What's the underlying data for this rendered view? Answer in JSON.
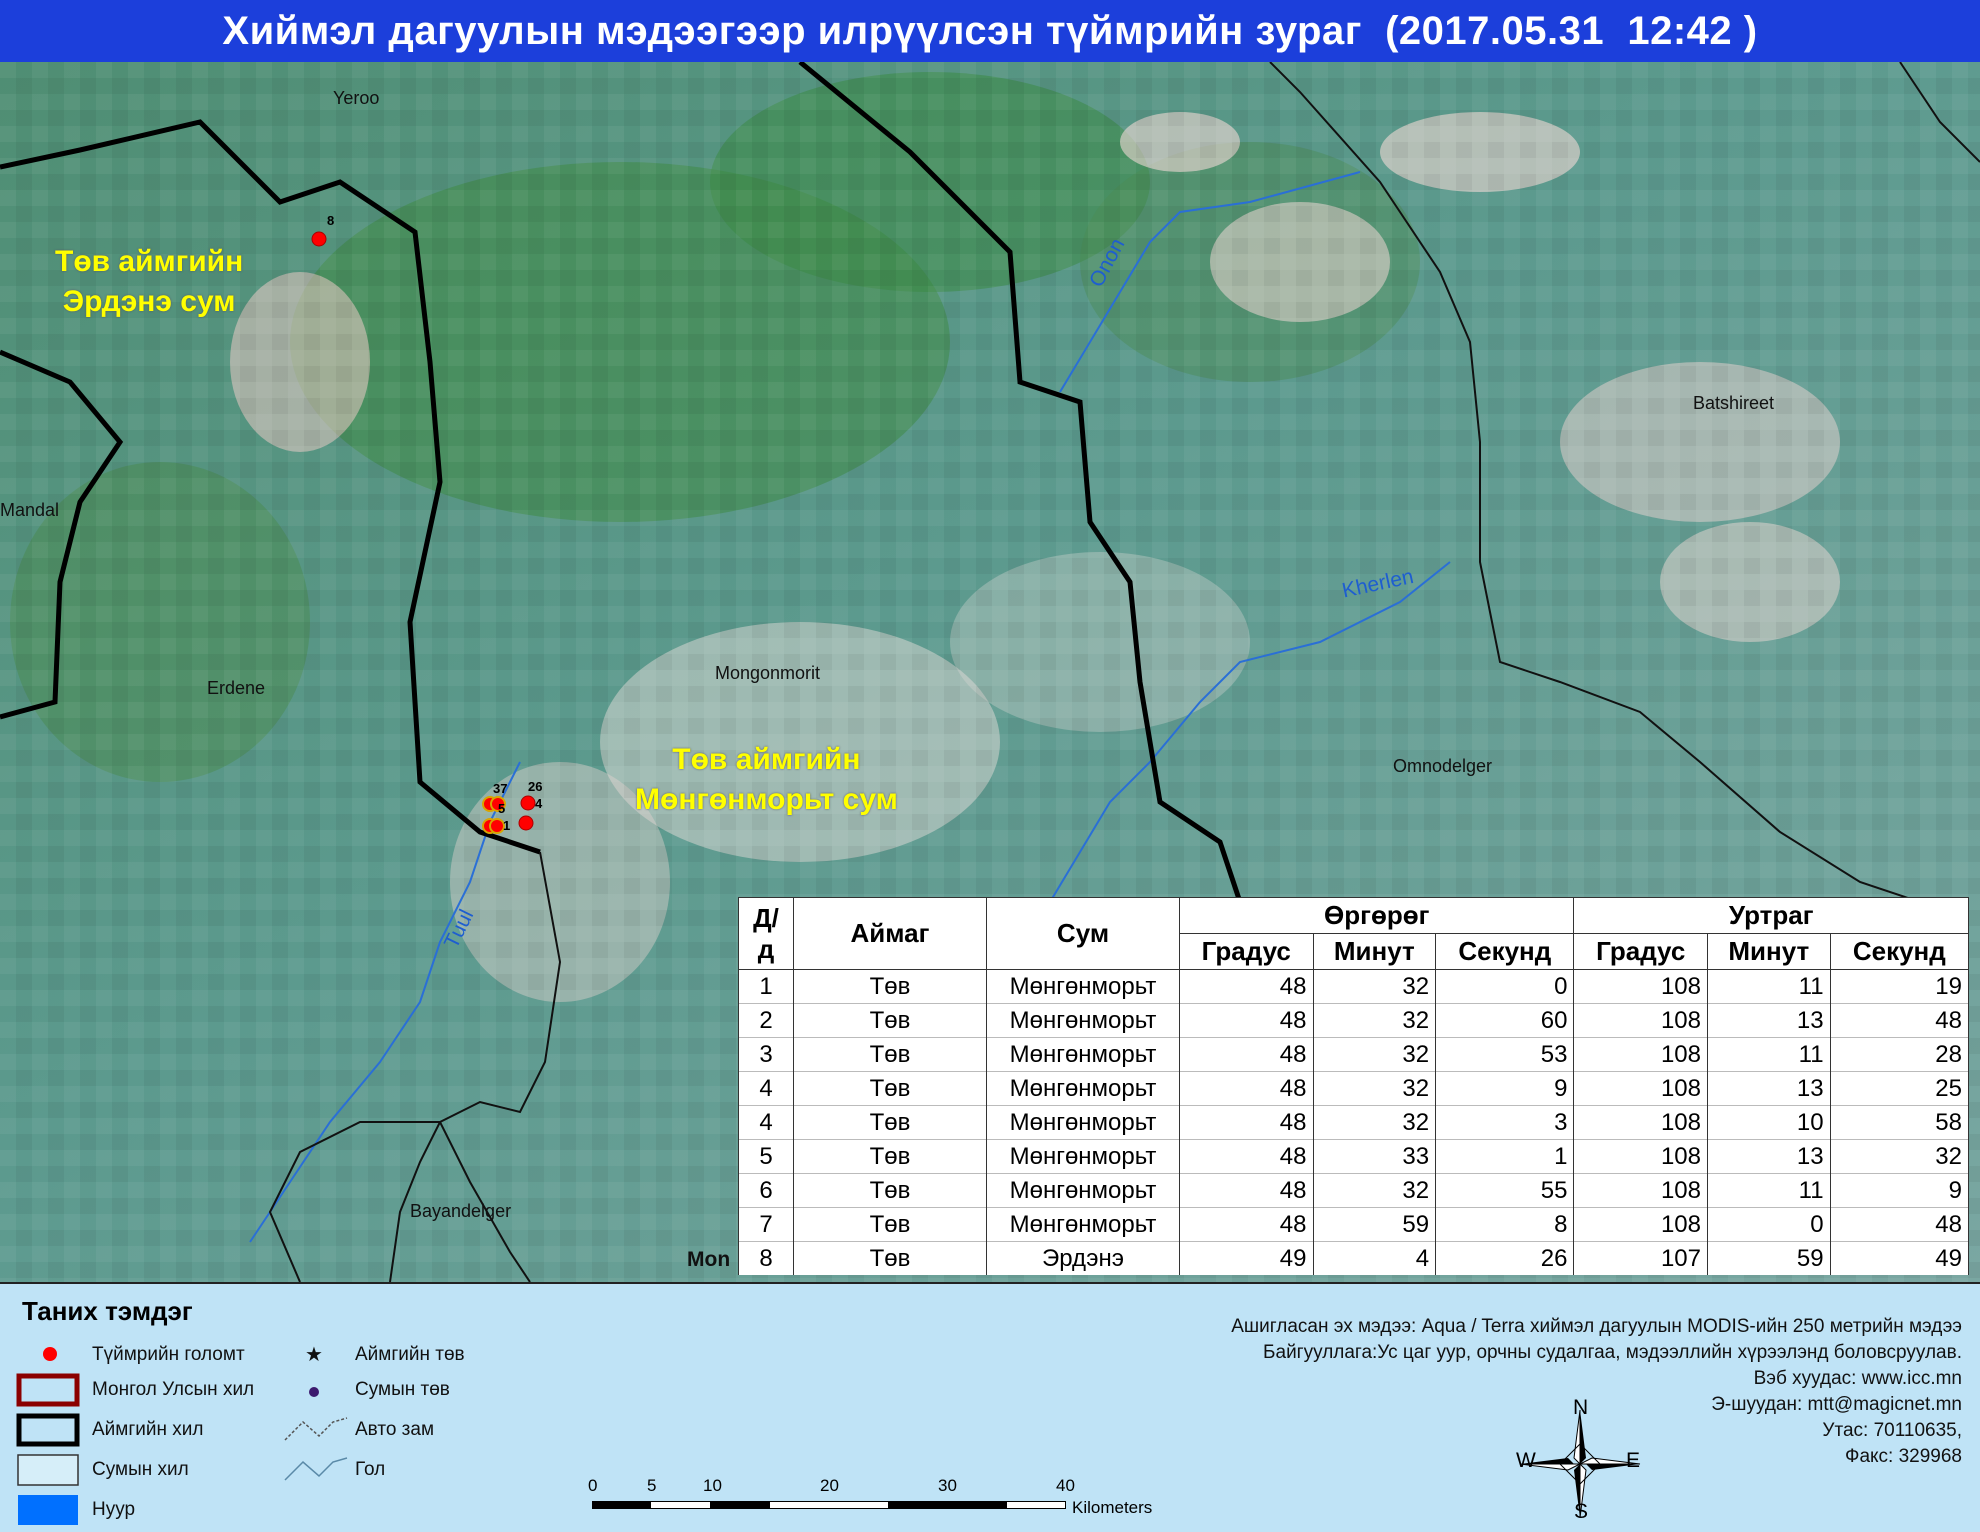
{
  "title": "Хиймэл дагуулын мэдээгээр илрүүлсэн түймрийн зураг  (2017.05.31  12:42 )",
  "map": {
    "places": [
      "Yeroo",
      "Mandal",
      "Erdene",
      "Mongonmorit",
      "Batshireet",
      "Omnodelger",
      "Bayandelger",
      "Mon"
    ],
    "rivers": [
      "Onon",
      "Kherlen",
      "Tuul"
    ],
    "regions": [
      {
        "line1": "Төв аймгийн",
        "line2": "Эрдэнэ сум"
      },
      {
        "line1": "Төв аймгийн",
        "line2": "Мөнгөнморьт сум"
      }
    ],
    "fire_labels": [
      "8",
      "37",
      "26",
      "5",
      "4",
      "1"
    ]
  },
  "table": {
    "headers": {
      "no": "Д/д",
      "aimag": "Аймаг",
      "sum": "Сум",
      "latitude": "Өргөрөг",
      "longitude": "Уртраг",
      "deg": "Градус",
      "min": "Минут",
      "sec": "Секунд"
    },
    "rows": [
      {
        "no": "1",
        "aimag": "Төв",
        "sum": "Мөнгөнморьт",
        "lat_d": "48",
        "lat_m": "32",
        "lat_s": "0",
        "lon_d": "108",
        "lon_m": "11",
        "lon_s": "19"
      },
      {
        "no": "2",
        "aimag": "Төв",
        "sum": "Мөнгөнморьт",
        "lat_d": "48",
        "lat_m": "32",
        "lat_s": "60",
        "lon_d": "108",
        "lon_m": "13",
        "lon_s": "48"
      },
      {
        "no": "3",
        "aimag": "Төв",
        "sum": "Мөнгөнморьт",
        "lat_d": "48",
        "lat_m": "32",
        "lat_s": "53",
        "lon_d": "108",
        "lon_m": "11",
        "lon_s": "28"
      },
      {
        "no": "4",
        "aimag": "Төв",
        "sum": "Мөнгөнморьт",
        "lat_d": "48",
        "lat_m": "32",
        "lat_s": "9",
        "lon_d": "108",
        "lon_m": "13",
        "lon_s": "25"
      },
      {
        "no": "4",
        "aimag": "Төв",
        "sum": "Мөнгөнморьт",
        "lat_d": "48",
        "lat_m": "32",
        "lat_s": "3",
        "lon_d": "108",
        "lon_m": "10",
        "lon_s": "58"
      },
      {
        "no": "5",
        "aimag": "Төв",
        "sum": "Мөнгөнморьт",
        "lat_d": "48",
        "lat_m": "33",
        "lat_s": "1",
        "lon_d": "108",
        "lon_m": "13",
        "lon_s": "32"
      },
      {
        "no": "6",
        "aimag": "Төв",
        "sum": "Мөнгөнморьт",
        "lat_d": "48",
        "lat_m": "32",
        "lat_s": "55",
        "lon_d": "108",
        "lon_m": "11",
        "lon_s": "9"
      },
      {
        "no": "7",
        "aimag": "Төв",
        "sum": "Мөнгөнморьт",
        "lat_d": "48",
        "lat_m": "59",
        "lat_s": "8",
        "lon_d": "108",
        "lon_m": "0",
        "lon_s": "48"
      },
      {
        "no": "8",
        "aimag": "Төв",
        "sum": "Эрдэнэ",
        "lat_d": "49",
        "lat_m": "4",
        "lat_s": "26",
        "lon_d": "107",
        "lon_m": "59",
        "lon_s": "49"
      }
    ]
  },
  "legend": {
    "title": "Таних тэмдэг",
    "items": {
      "fire": "Түймрийн голомт",
      "national": "Монгол Улсын хил",
      "aimag": "Аймгийн хил",
      "sum": "Сумын хил",
      "lake": "Нуур",
      "aimag_center": "Аймгийн төв",
      "sum_center": "Сумын төв",
      "road": "Авто зам",
      "river": "Гол"
    }
  },
  "info": [
    "Ашигласан эх мэдээ: Aqua / Terra хиймэл дагуулын MODIS-ийн 250 метрийн мэдээ",
    "Байгууллага:Ус цаг уур, орчны судалгаа, мэдээллийн хүрээлэнд боловсруулав.",
    "Вэб хуудас: www.icc.mn",
    "Э-шуудан: mtt@magicnet.mn",
    "Утас: 70110635,",
    "Факс: 329968"
  ],
  "scale": {
    "ticks": [
      "0",
      "5",
      "10",
      "20",
      "30",
      "40"
    ],
    "unit": "Kilometers"
  },
  "compass": {
    "n": "N",
    "s": "S",
    "e": "E",
    "w": "W"
  },
  "colors": {
    "title_bg": "#1c3fdb",
    "fire": "#ff0000",
    "legend_bg": "#bfe3f6",
    "region_label": "#ffff00",
    "river": "#2a6fd6"
  }
}
